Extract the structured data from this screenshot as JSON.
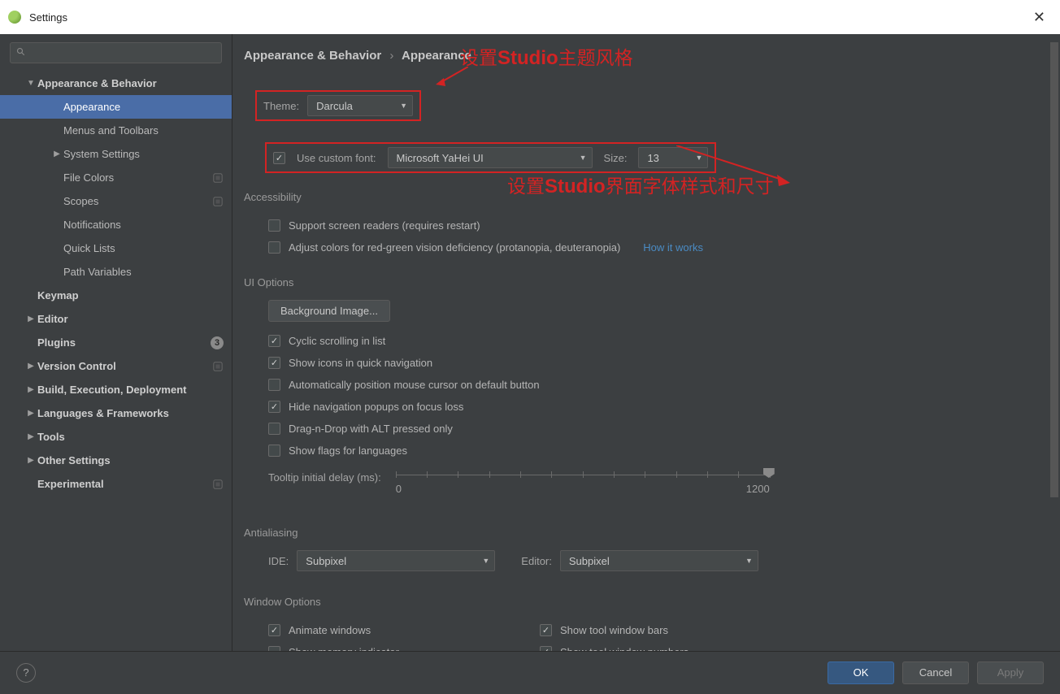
{
  "window": {
    "title": "Settings"
  },
  "sidebar": {
    "search_placeholder": "",
    "items": [
      {
        "label": "Appearance & Behavior",
        "bold": true,
        "arrow": "down",
        "indent": 1
      },
      {
        "label": "Appearance",
        "indent": 2,
        "selected": true
      },
      {
        "label": "Menus and Toolbars",
        "indent": 2
      },
      {
        "label": "System Settings",
        "indent": 2,
        "arrow": "right"
      },
      {
        "label": "File Colors",
        "indent": 2,
        "project": true
      },
      {
        "label": "Scopes",
        "indent": 2,
        "project": true
      },
      {
        "label": "Notifications",
        "indent": 2
      },
      {
        "label": "Quick Lists",
        "indent": 2
      },
      {
        "label": "Path Variables",
        "indent": 2
      },
      {
        "label": "Keymap",
        "bold": true,
        "indent": 1
      },
      {
        "label": "Editor",
        "bold": true,
        "indent": 1,
        "arrow": "right"
      },
      {
        "label": "Plugins",
        "bold": true,
        "indent": 1,
        "badge": "3"
      },
      {
        "label": "Version Control",
        "bold": true,
        "indent": 1,
        "arrow": "right",
        "project": true
      },
      {
        "label": "Build, Execution, Deployment",
        "bold": true,
        "indent": 1,
        "arrow": "right"
      },
      {
        "label": "Languages & Frameworks",
        "bold": true,
        "indent": 1,
        "arrow": "right"
      },
      {
        "label": "Tools",
        "bold": true,
        "indent": 1,
        "arrow": "right"
      },
      {
        "label": "Other Settings",
        "bold": true,
        "indent": 1,
        "arrow": "right"
      },
      {
        "label": "Experimental",
        "bold": true,
        "indent": 1,
        "project": true
      }
    ]
  },
  "breadcrumb": {
    "a": "Appearance & Behavior",
    "b": "Appearance"
  },
  "theme": {
    "label": "Theme:",
    "value": "Darcula"
  },
  "font": {
    "custom_label": "Use custom font:",
    "custom_checked": true,
    "family": "Microsoft YaHei UI",
    "size_label": "Size:",
    "size": "13"
  },
  "annotations": {
    "theme": "设置Studio主题风格",
    "font": "设置Studio界面字体样式和尺寸"
  },
  "accessibility": {
    "title": "Accessibility",
    "screen_readers": {
      "label": "Support screen readers (requires restart)",
      "checked": false
    },
    "color_deficiency": {
      "label": "Adjust colors for red-green vision deficiency (protanopia, deuteranopia)",
      "checked": false
    },
    "how_it_works": "How it works"
  },
  "ui_options": {
    "title": "UI Options",
    "bg_button": "Background Image...",
    "opts": [
      {
        "label": "Cyclic scrolling in list",
        "checked": true
      },
      {
        "label": "Show icons in quick navigation",
        "checked": true
      },
      {
        "label": "Automatically position mouse cursor on default button",
        "checked": false
      },
      {
        "label": "Hide navigation popups on focus loss",
        "checked": true
      },
      {
        "label": "Drag-n-Drop with ALT pressed only",
        "checked": false
      },
      {
        "label": "Show flags for languages",
        "checked": false
      }
    ],
    "tooltip_label": "Tooltip initial delay (ms):",
    "tooltip_min": "0",
    "tooltip_max": "1200"
  },
  "antialiasing": {
    "title": "Antialiasing",
    "ide_label": "IDE:",
    "ide_value": "Subpixel",
    "editor_label": "Editor:",
    "editor_value": "Subpixel"
  },
  "window_options": {
    "title": "Window Options",
    "col1": [
      {
        "label": "Animate windows",
        "checked": true
      },
      {
        "label": "Show memory indicator",
        "checked": false
      }
    ],
    "col2": [
      {
        "label": "Show tool window bars",
        "checked": true
      },
      {
        "label": "Show tool window numbers",
        "checked": true
      }
    ]
  },
  "footer": {
    "ok": "OK",
    "cancel": "Cancel",
    "apply": "Apply"
  }
}
